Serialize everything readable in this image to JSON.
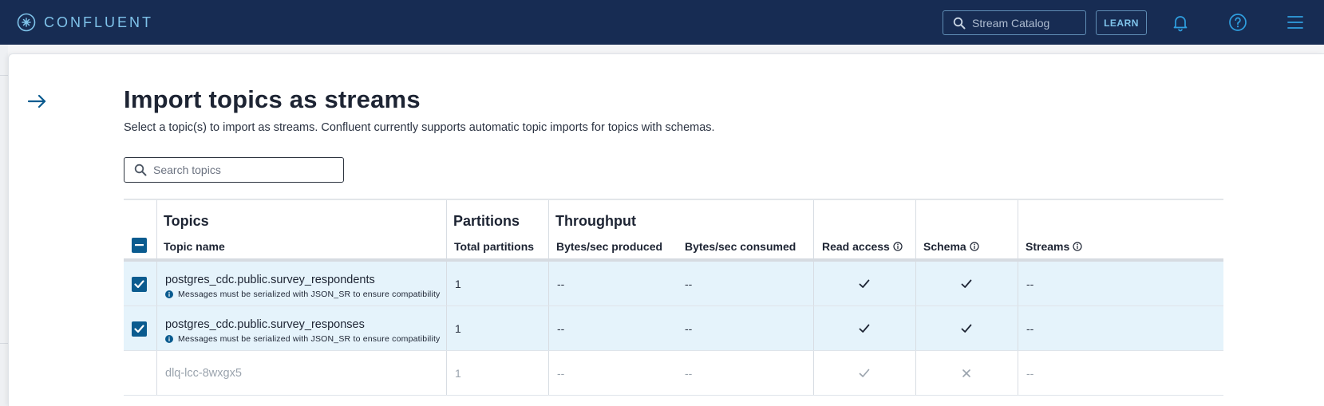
{
  "header": {
    "brand": "CONFLUENT",
    "catalog_search_placeholder": "Stream Catalog",
    "learn_label": "LEARN",
    "icons": [
      "bell-icon",
      "help-icon",
      "menu-icon"
    ]
  },
  "page": {
    "title": "Import topics as streams",
    "subtitle": "Select a topic(s) to import as streams. Confluent currently supports automatic topic imports for topics with schemas.",
    "search_placeholder": "Search topics"
  },
  "table": {
    "groups": {
      "topics": "Topics",
      "partitions": "Partitions",
      "throughput": "Throughput"
    },
    "columns": {
      "topic_name": "Topic name",
      "total_partitions": "Total partitions",
      "bytes_produced": "Bytes/sec produced",
      "bytes_consumed": "Bytes/sec consumed",
      "read_access": "Read access",
      "schema": "Schema",
      "streams": "Streams"
    },
    "header_checkbox_state": "indeterminate",
    "rows": [
      {
        "selected": true,
        "topic": "postgres_cdc.public.survey_respondents",
        "note": "Messages must be serialized with JSON_SR to ensure compatibility",
        "partitions": "1",
        "produced": "--",
        "consumed": "--",
        "read_access": "check",
        "schema": "check",
        "streams": "--"
      },
      {
        "selected": true,
        "topic": "postgres_cdc.public.survey_responses",
        "note": "Messages must be serialized with JSON_SR to ensure compatibility",
        "partitions": "1",
        "produced": "--",
        "consumed": "--",
        "read_access": "check",
        "schema": "check",
        "streams": "--"
      },
      {
        "selected": false,
        "topic": "dlq-lcc-8wxgx5",
        "partitions": "1",
        "produced": "--",
        "consumed": "--",
        "read_access": "check",
        "schema": "cross",
        "streams": "--"
      }
    ]
  },
  "colors": {
    "topbar": "#172c53",
    "brand_accent": "#7fc3ea",
    "checkbox": "#0a5b8f",
    "selected_row": "#e5f3fb"
  }
}
